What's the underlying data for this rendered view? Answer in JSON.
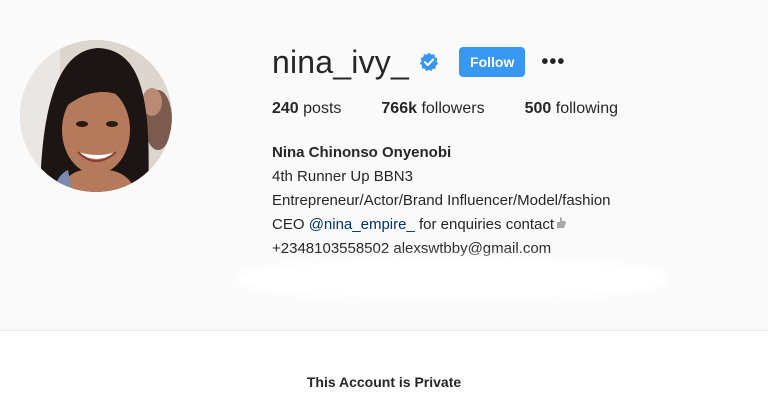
{
  "profile": {
    "username": "nina_ivy_",
    "verified": true,
    "follow_label": "Follow",
    "more_icon": "more-options-icon"
  },
  "stats": {
    "posts_count": "240",
    "posts_label": "posts",
    "followers_count": "766k",
    "followers_label": "followers",
    "following_count": "500",
    "following_label": "following"
  },
  "bio": {
    "full_name": "Nina Chinonso Onyenobi",
    "line1": "4th Runner Up BBN3",
    "line2": "Entrepreneur/Actor/Brand Influencer/Model/fashion",
    "line3_prefix": "CEO ",
    "line3_mention": "@nina_empire_",
    "line3_suffix": " for enquiries contact",
    "line4": "+2348103558502 alexswtbby@gmail.com"
  },
  "private_notice": "This Account is Private",
  "colors": {
    "accent": "#3897f0",
    "text": "#262626",
    "background": "#fafafa",
    "mention": "#003569"
  }
}
